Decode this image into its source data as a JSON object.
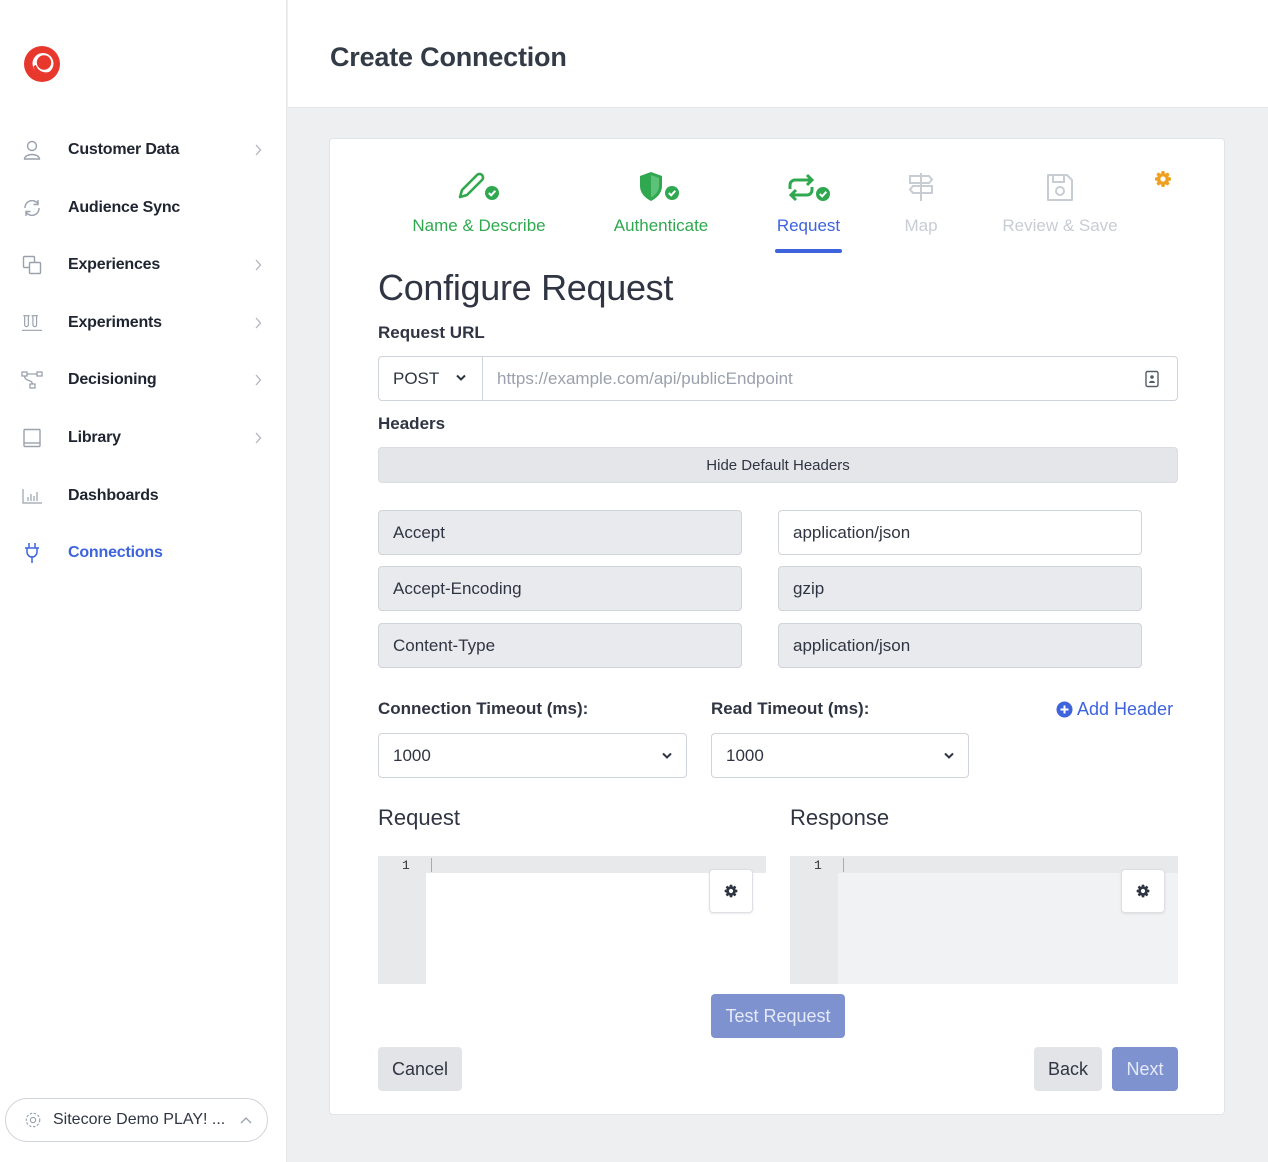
{
  "colors": {
    "accent": "#3d63dd",
    "success": "#2fa84f",
    "brand": "#e8382d",
    "disabled": "#c8ccd3",
    "warning": "#f0a020"
  },
  "sidebar": {
    "items": [
      {
        "label": "Customer Data",
        "icon": "person-icon",
        "has_chevron": true
      },
      {
        "label": "Audience Sync",
        "icon": "sync-icon",
        "has_chevron": false
      },
      {
        "label": "Experiences",
        "icon": "layers-icon",
        "has_chevron": true
      },
      {
        "label": "Experiments",
        "icon": "beakers-icon",
        "has_chevron": true
      },
      {
        "label": "Decisioning",
        "icon": "flow-icon",
        "has_chevron": true
      },
      {
        "label": "Library",
        "icon": "book-icon",
        "has_chevron": true
      },
      {
        "label": "Dashboards",
        "icon": "bar-chart-icon",
        "has_chevron": false
      },
      {
        "label": "Connections",
        "icon": "plug-icon",
        "has_chevron": false,
        "active": true
      }
    ],
    "org_switcher": {
      "label": "Sitecore Demo PLAY! ...",
      "icon": "gear-icon"
    }
  },
  "header": {
    "title": "Create Connection"
  },
  "wizard": {
    "steps": [
      {
        "label": "Name & Describe",
        "state": "done",
        "icon": "pencil-check-icon"
      },
      {
        "label": "Authenticate",
        "state": "done",
        "icon": "shield-check-icon"
      },
      {
        "label": "Request",
        "state": "current",
        "icon": "repeat-check-icon"
      },
      {
        "label": "Map",
        "state": "todo",
        "icon": "signpost-icon"
      },
      {
        "label": "Review & Save",
        "state": "todo",
        "icon": "floppy-icon"
      }
    ]
  },
  "form": {
    "section_title": "Configure Request",
    "request_url_label": "Request URL",
    "method": "POST",
    "url_value": "",
    "url_placeholder": "https://example.com/api/publicEndpoint",
    "headers_label": "Headers",
    "hide_defaults_label": "Hide Default Headers",
    "headers": [
      {
        "key": "Accept",
        "value": "application/json",
        "value_editable": true
      },
      {
        "key": "Accept-Encoding",
        "value": "gzip",
        "value_editable": false
      },
      {
        "key": "Content-Type",
        "value": "application/json",
        "value_editable": false
      }
    ],
    "add_header_label": "Add Header",
    "connection_timeout_label": "Connection Timeout (ms):",
    "connection_timeout_value": "1000",
    "read_timeout_label": "Read Timeout (ms):",
    "read_timeout_value": "1000",
    "request_editor": {
      "title": "Request",
      "line_number": "1"
    },
    "response_editor": {
      "title": "Response",
      "line_number": "1"
    },
    "test_request_label": "Test Request"
  },
  "footer": {
    "cancel_label": "Cancel",
    "back_label": "Back",
    "next_label": "Next"
  }
}
